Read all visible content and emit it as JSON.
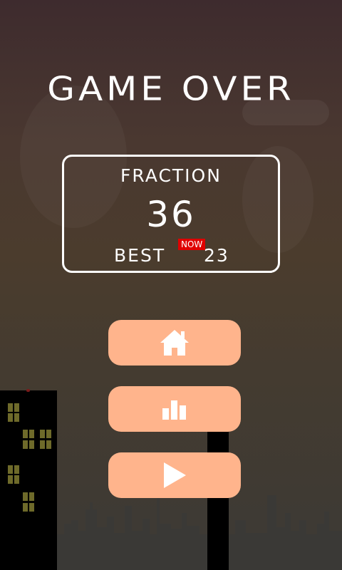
{
  "game": {
    "title": "GAME OVER",
    "score_label": "FRACTION",
    "score_value": "36",
    "best_label": "BEST",
    "best_value": "23",
    "new_badge": "NOW"
  },
  "buttons": [
    {
      "name": "home",
      "icon": "home-icon"
    },
    {
      "name": "leaderboard",
      "icon": "bar-chart-icon"
    },
    {
      "name": "play",
      "icon": "play-icon"
    }
  ],
  "colors": {
    "button_bg": "#ffb48c",
    "badge_bg": "#e00000",
    "text": "#ffffff"
  }
}
